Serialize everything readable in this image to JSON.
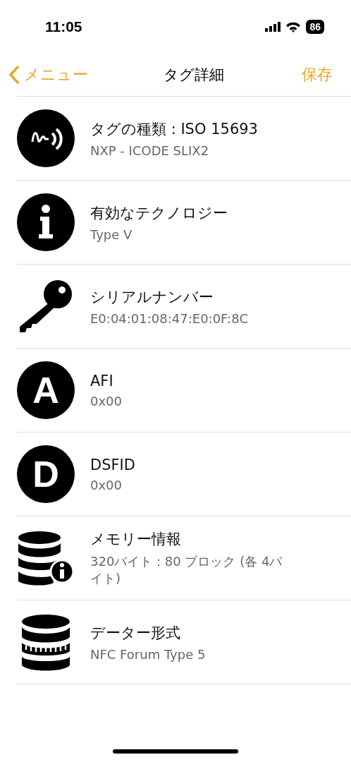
{
  "status_bar": {
    "time": "11:05",
    "battery": "86"
  },
  "nav_bar": {
    "back": "メニュー",
    "title": "タグ詳細",
    "action": "保存"
  },
  "rows": [
    {
      "kind": "nfc",
      "title": "タグの種類 : ISO 15693",
      "value": "NXP - ICODE SLIX2"
    },
    {
      "kind": "info",
      "title": "有効なテクノロジー",
      "value": "Type V"
    },
    {
      "kind": "key",
      "title": "シリアルナンバー",
      "value": "E0:04:01:08:47:E0:0F:8C"
    },
    {
      "kind": "letter",
      "letter": "A",
      "title": "AFI",
      "value": "0x00"
    },
    {
      "kind": "letter",
      "letter": "D",
      "title": "DSFID",
      "value": "0x00"
    },
    {
      "kind": "database-info",
      "title": "メモリー情報",
      "value": "320バイト : 80 ブロック (各 4バイト)"
    },
    {
      "kind": "database",
      "title": "データー形式",
      "value": "NFC Forum Type 5"
    }
  ]
}
